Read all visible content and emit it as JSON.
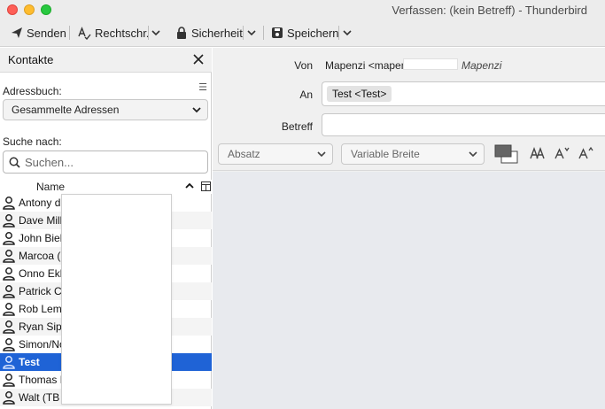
{
  "window": {
    "title": "Verfassen: (kein Betreff) - Thunderbird"
  },
  "toolbar": {
    "send_label": "Senden",
    "spelling_label": "Rechtschr.",
    "security_label": "Sicherheit",
    "save_label": "Speichern"
  },
  "sidebar": {
    "title": "Kontakte",
    "addressbook_label": "Adressbuch:",
    "addressbook_value": "Gesammelte Adressen",
    "search_label": "Suche nach:",
    "search_placeholder": "Suchen...",
    "column_name": "Name",
    "contacts": [
      {
        "name": "Antony d"
      },
      {
        "name": "Dave Mill"
      },
      {
        "name": "John Biel"
      },
      {
        "name": "Marcoa ("
      },
      {
        "name": "Onno Ekk"
      },
      {
        "name": "Patrick C"
      },
      {
        "name": "Rob Leml"
      },
      {
        "name": "Ryan Sipe"
      },
      {
        "name": "Simon/No"
      },
      {
        "name": "Test"
      },
      {
        "name": "Thomas I"
      },
      {
        "name": "Walt (TB"
      }
    ],
    "selected_index": 9
  },
  "compose": {
    "from_label": "Von",
    "from_value": "Mapenzi <mapen",
    "from_identity": "Mapenzi",
    "to_label": "An",
    "to_recipient": "Test <Test>",
    "subject_label": "Betreff",
    "subject_value": ""
  },
  "format": {
    "paragraph": "Absatz",
    "font": "Variable Breite"
  },
  "colors": {
    "selection": "#1f63d6",
    "toolbar_bg": "#ececec",
    "editor_bg": "#e8eaee"
  }
}
